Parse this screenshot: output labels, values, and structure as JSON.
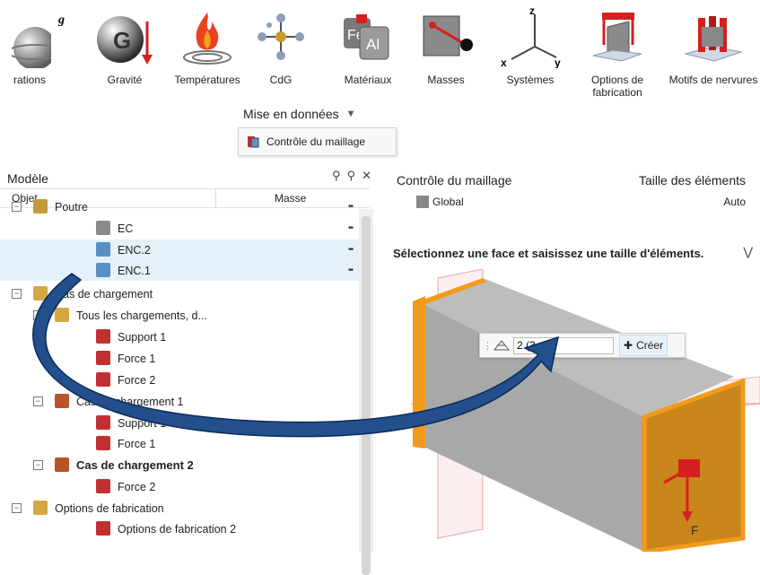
{
  "ribbon": {
    "buttons": [
      {
        "label": "rations",
        "icon": "sphere-rotation-icon"
      },
      {
        "label": "Gravité",
        "icon": "gravity-icon"
      },
      {
        "label": "Températures",
        "icon": "temperature-flame-icon"
      },
      {
        "label": "CdG",
        "icon": "center-of-gravity-icon"
      },
      {
        "label": "Matériaux",
        "icon": "materials-fe-al-icon"
      },
      {
        "label": "Masses",
        "icon": "mass-icon"
      },
      {
        "label": "Systèmes",
        "icon": "coordinate-system-icon"
      },
      {
        "label": "Options de fabrication",
        "icon": "manufacturing-options-icon"
      },
      {
        "label": "Motifs de nervures",
        "icon": "rib-patterns-icon"
      }
    ],
    "axis_labels": {
      "z": "z",
      "x": "x",
      "y": "y"
    },
    "gravity_letter": "G",
    "g_letter": "g",
    "fe": "Fe",
    "al": "Al",
    "group_label": "Mise en données",
    "group_arrow": "▼"
  },
  "dropdown": {
    "item_label": "Contrôle du maillage",
    "icon": "mesh-control-icon"
  },
  "tree": {
    "title": "Modèle",
    "tools": [
      "binoculars-icon",
      "search-icon",
      "close-icon"
    ],
    "col_object": "Objet",
    "col_mass": "Masse",
    "rows": [
      {
        "label": "Poutre",
        "exp": "−",
        "mass": "••",
        "icon": "part-folder-icon"
      },
      {
        "label": "EC",
        "mass": "••",
        "icon": "part-gray-icon"
      },
      {
        "label": "ENC.2",
        "mass": "••",
        "icon": "part-blue-icon",
        "selected": true
      },
      {
        "label": "ENC.1",
        "mass": "••",
        "icon": "part-blue-icon",
        "selected": true
      },
      {
        "label": "Cas de chargement",
        "exp": "−",
        "icon": "folder-icon"
      },
      {
        "label": "Tous les chargements, d...",
        "exp": "−",
        "icon": "folder-icon"
      },
      {
        "label": "Support 1",
        "icon": "support-icon"
      },
      {
        "label": "Force 1",
        "icon": "force-icon"
      },
      {
        "label": "Force 2",
        "icon": "force-icon"
      },
      {
        "label": "Cas de chargement 1",
        "exp": "−",
        "icon": "load-case-icon"
      },
      {
        "label": "Support 1",
        "icon": "support-icon"
      },
      {
        "label": "Force 1",
        "icon": "force-icon"
      },
      {
        "label": "Cas de chargement 2",
        "exp": "−",
        "icon": "load-case-icon",
        "bold": true
      },
      {
        "label": "Force 2",
        "icon": "force-icon"
      },
      {
        "label": "Options de fabrication",
        "exp": "−",
        "icon": "folder-icon"
      },
      {
        "label": "Options de fabrication 2",
        "icon": "manufacturing-icon"
      }
    ]
  },
  "mesh_panel": {
    "title": "Contrôle du maillage",
    "size_header": "Taille des éléments",
    "global_label": "Global",
    "global_value": "Auto",
    "instruction": "Sélectionnez une face et saisissez une taille d'éléments.",
    "collapse_icon": "double-chevron-down-icon"
  },
  "float_bar": {
    "input_value": "2 (3",
    "create_label": "Créer"
  },
  "viewport": {
    "force_label": "F"
  },
  "colors": {
    "face_orange": "#c8861b",
    "edge_orange": "#f29a1a",
    "box_gray": "#a8a8a8",
    "arrow_blue": "#1f4f8f",
    "selection": "#e4f1f9",
    "force_red": "#d42020"
  }
}
